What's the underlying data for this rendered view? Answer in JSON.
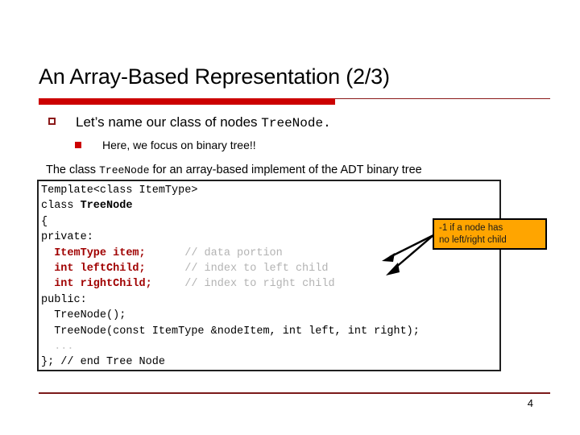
{
  "slide": {
    "title": "An Array-Based Representation (2/3)",
    "page_number": "4",
    "accent_color": "#CC0000",
    "rule_color": "#8B1A1A"
  },
  "bullets": {
    "level1": {
      "marker": "hollow-square-bullet",
      "text_before": "Let’s name our class of nodes ",
      "code_term": "TreeNode",
      "text_after": "."
    },
    "level2": {
      "marker": "filled-square-bullet",
      "text": "Here, we focus on binary tree!!"
    }
  },
  "caption": {
    "text_before": "The class ",
    "code_term": "TreeNode",
    "text_after": " for an array-based implement of the ADT binary tree"
  },
  "code": {
    "lines": [
      [
        {
          "t": "Template<class ItemType>",
          "s": "plain"
        }
      ],
      [
        {
          "t": "class ",
          "s": "plain"
        },
        {
          "t": "TreeNode",
          "s": "bold"
        }
      ],
      [
        {
          "t": "{",
          "s": "plain"
        }
      ],
      [
        {
          "t": "private:",
          "s": "plain"
        }
      ],
      [
        {
          "t": "  ",
          "s": "plain"
        },
        {
          "t": "ItemType item;",
          "s": "member"
        },
        {
          "t": "      ",
          "s": "plain"
        },
        {
          "t": "// data portion",
          "s": "cmt"
        }
      ],
      [
        {
          "t": "  ",
          "s": "plain"
        },
        {
          "t": "int leftChild;",
          "s": "member"
        },
        {
          "t": "      ",
          "s": "plain"
        },
        {
          "t": "// index to left child",
          "s": "cmt"
        }
      ],
      [
        {
          "t": "  ",
          "s": "plain"
        },
        {
          "t": "int rightChild;",
          "s": "member"
        },
        {
          "t": "     ",
          "s": "plain"
        },
        {
          "t": "// index to right child",
          "s": "cmt"
        }
      ],
      [
        {
          "t": "public:",
          "s": "plain"
        }
      ],
      [
        {
          "t": "  TreeNode();",
          "s": "plain"
        }
      ],
      [
        {
          "t": "  TreeNode(const ItemType &nodeItem, int left, int right);",
          "s": "plain"
        }
      ],
      [
        {
          "t": "  ...",
          "s": "dots"
        }
      ],
      [
        {
          "t": "}; // end Tree Node",
          "s": "plain"
        }
      ]
    ],
    "colors": {
      "member": "#A00000",
      "comment": "#B3B3B3",
      "plain": "#000000"
    }
  },
  "callout": {
    "line1": "-1 if a node has",
    "line2": "no left/right child",
    "fill_color": "#FFA500",
    "border_color": "#000000",
    "arrow_targets": [
      "leftChild-comment",
      "rightChild-comment"
    ]
  }
}
